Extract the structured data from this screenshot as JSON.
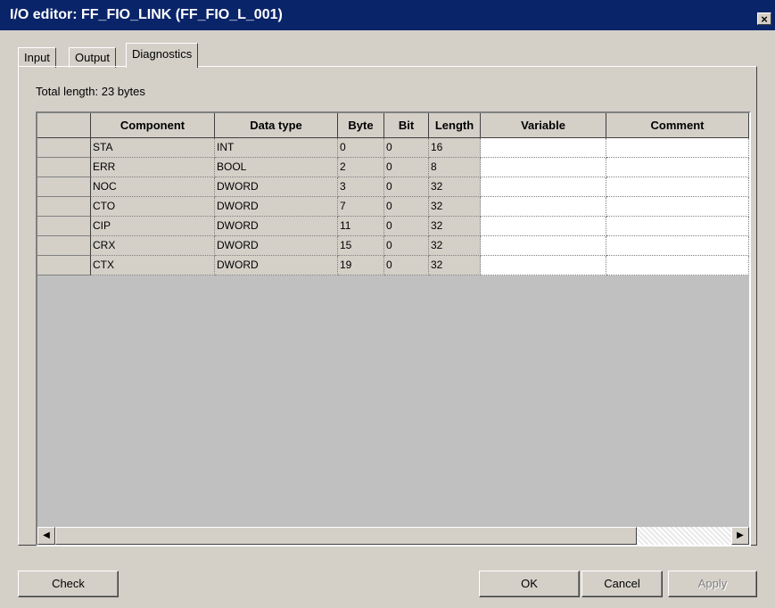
{
  "window": {
    "title": "I/O editor: FF_FIO_LINK (FF_FIO_L_001)",
    "close_glyph": "×"
  },
  "tabs": [
    "Input",
    "Output",
    "Diagnostics"
  ],
  "active_tab": "Diagnostics",
  "total_length": "Total length: 23 bytes",
  "table": {
    "columns": [
      "Component",
      "Data type",
      "Byte",
      "Bit",
      "Length",
      "Variable",
      "Comment"
    ],
    "rows": [
      [
        "STA",
        "INT",
        "0",
        "0",
        "16",
        "",
        ""
      ],
      [
        "ERR",
        "BOOL",
        "2",
        "0",
        "8",
        "",
        ""
      ],
      [
        "NOC",
        "DWORD",
        "3",
        "0",
        "32",
        "",
        ""
      ],
      [
        "CTO",
        "DWORD",
        "7",
        "0",
        "32",
        "",
        ""
      ],
      [
        "CIP",
        "DWORD",
        "11",
        "0",
        "32",
        "",
        ""
      ],
      [
        "CRX",
        "DWORD",
        "15",
        "0",
        "32",
        "",
        ""
      ],
      [
        "CTX",
        "DWORD",
        "19",
        "0",
        "32",
        "",
        ""
      ]
    ]
  },
  "scroll_left_glyph": "◀",
  "scroll_right_glyph": "▶",
  "buttons": {
    "check": "Check",
    "ok": "OK",
    "cancel": "Cancel",
    "apply": "Apply"
  },
  "colors": {
    "title_bar": "#0a246a",
    "dialog_bg": "#d4d0c8",
    "editable_cell": "#ffffff"
  }
}
